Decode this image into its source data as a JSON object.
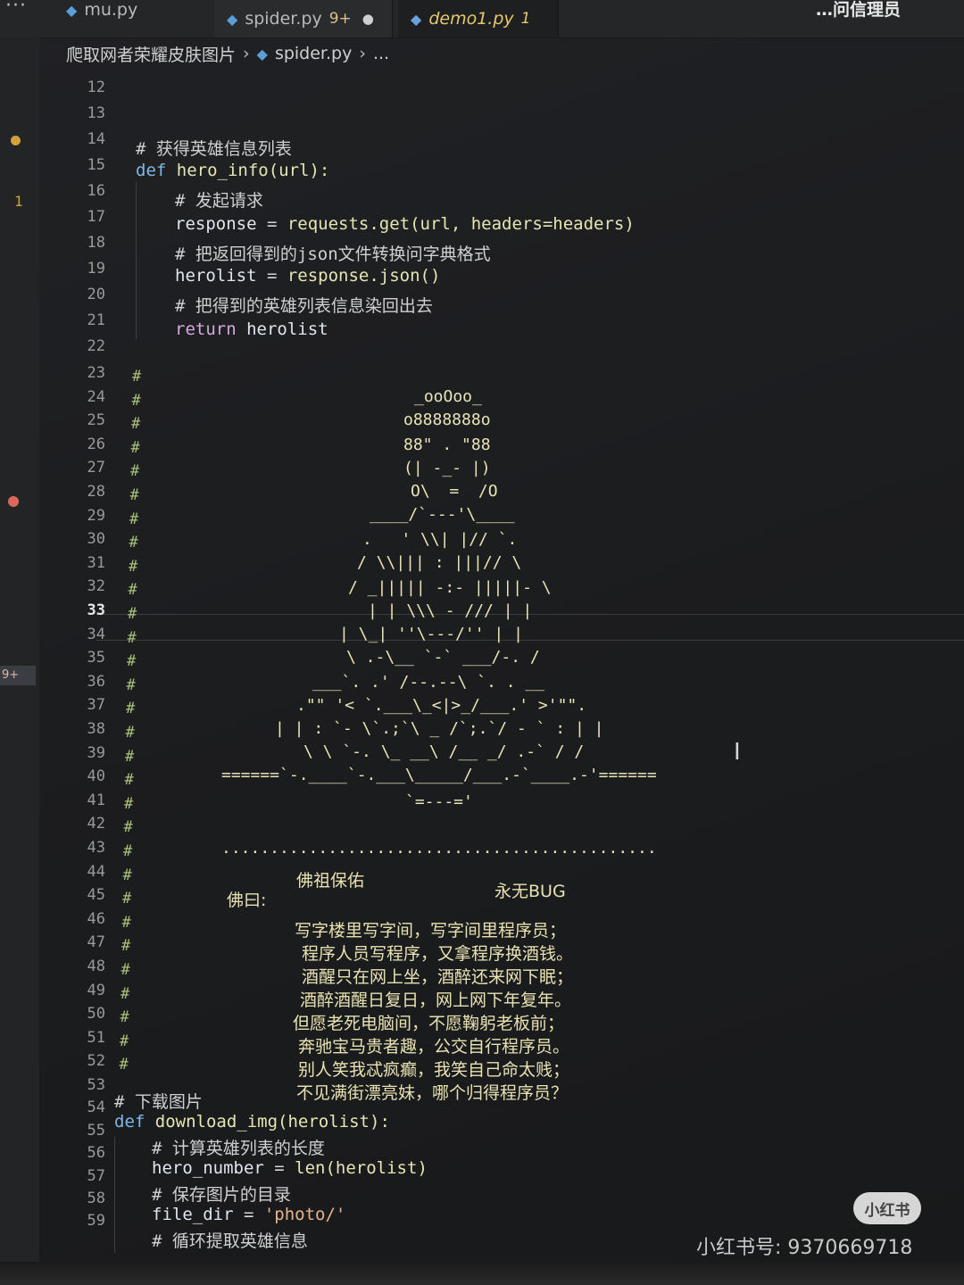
{
  "tabs": [
    {
      "icon": "python-file-icon",
      "label": "mu.py"
    },
    {
      "icon": "python-file-icon",
      "label": "spider.py",
      "badge": "9+",
      "dirty_icon": "●"
    },
    {
      "icon": "python-file-icon",
      "label": "demo1.py",
      "badge": "1"
    },
    {
      "label": "…问信理员"
    }
  ],
  "breadcrumb": {
    "folder": "爬取网者荣耀皮肤图片",
    "file": "spider.py",
    "more": "..."
  },
  "markers": {
    "badge_9plus": "9+",
    "error_count": "1"
  },
  "gutter": {
    "numbers": [
      "12",
      "13",
      "14",
      "15",
      "16",
      "17",
      "18",
      "19",
      "20",
      "21",
      "22",
      "23",
      "24",
      "25",
      "26",
      "27",
      "28",
      "29",
      "30",
      "31",
      "32",
      "33",
      "34",
      "35",
      "36",
      "37",
      "38",
      "39",
      "40",
      "41",
      "42",
      "43",
      "44",
      "45",
      "46",
      "47",
      "48",
      "49",
      "50",
      "51",
      "52",
      "53",
      "54",
      "55",
      "56",
      "57",
      "58",
      "59"
    ],
    "active": "33"
  },
  "code": {
    "c14": "# 获得英雄信息列表",
    "l15_def": "def",
    "l15_fn": "hero_info(url):",
    "c16": "# 发起请求",
    "l17_a": "response",
    "l17_b": " = ",
    "l17_c": "requests.get(url, headers=headers)",
    "c18": "# 把返回得到的json文件转换问字典格式",
    "l19_a": "herolist",
    "l19_b": " = ",
    "l19_c": "response.json()",
    "c20": "# 把得到的英雄列表信息染回出去",
    "l21_kw": "return",
    "l21_var": "herolist",
    "hash": "#",
    "c53": "# 下载图片",
    "l54_def": "def",
    "l54_fn": "download_img(herolist):",
    "c55": "# 计算英雄列表的长度",
    "l56_a": "hero_number",
    "l56_b": " = ",
    "l56_c": "len(herolist)",
    "c57": "# 保存图片的目录",
    "l58_a": "file_dir",
    "l58_b": " = ",
    "l58_c": "'photo/'",
    "c59": "# 循环提取英雄信息"
  },
  "ascii_art": {
    "lines": [
      "_ooOoo_",
      "o8888888o",
      "88\" . \"88",
      "(| -_- |)",
      "O\\  =  /O",
      "____/`---'\\____",
      ".   ' \\\\| |// `.",
      "/ \\\\||| : |||// \\",
      "/ _||||| -:- |||||- \\",
      "| | \\\\\\ - /// | |",
      "| \\_| ''\\---/'' | |",
      "\\ .-\\__ `-` ___/-. /",
      "___`. .' /--.--\\ `. . __",
      ".\"\" '< `.___\\_<|>_/___.' >'\"\".",
      "| | : `- \\`.;`\\ _ /`;.`/ - ` : | |",
      "\\ \\ `-. \\_ __\\ /__ _/ .-` / /",
      "======`-.____`-.___\\_____/___.-`____.-'======",
      "`=---='",
      "............................................."
    ],
    "blessing": "佛祖保佑",
    "nobug": "永无BUG",
    "buddha_says": "佛曰:",
    "poem": [
      "写字楼里写字间，写字间里程序员；",
      "程序人员写程序，又拿程序换酒钱。",
      "酒醒只在网上坐，酒醉还来网下眠；",
      "酒醉酒醒日复日，网上网下年复年。",
      "但愿老死电脑间，不愿鞠躬老板前；",
      "奔驰宝马贵者趣，公交自行程序员。",
      "别人笑我忒疯癫，我笑自己命太贱；",
      "不见满街漂亮妹，哪个归得程序员？"
    ]
  },
  "watermark": {
    "logo": "小红书",
    "id_text": "小红书号: 9370669718"
  }
}
